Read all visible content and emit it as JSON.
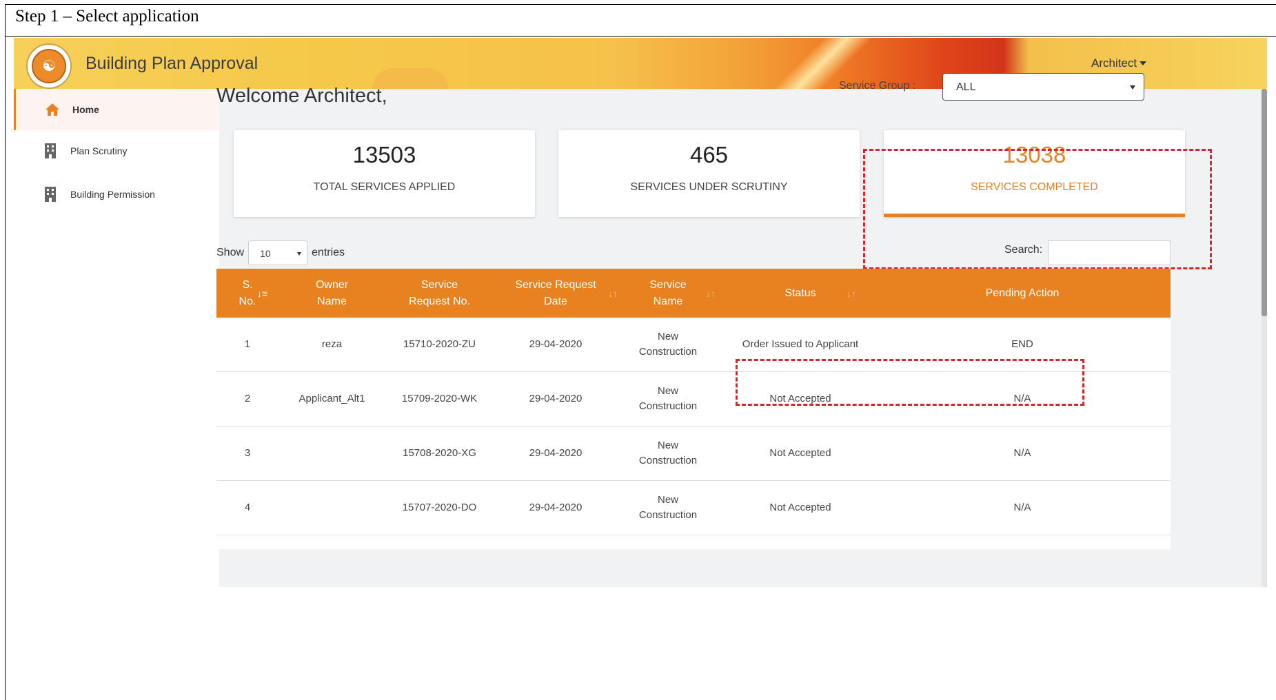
{
  "step_title": "Step 1 – Select application",
  "app": {
    "title": "Building Plan Approval",
    "user_menu": "Architect"
  },
  "sidebar": {
    "items": [
      {
        "label": "Home",
        "icon": "home-icon"
      },
      {
        "label": "Plan Scrutiny",
        "icon": "building-icon"
      },
      {
        "label": "Building Permission",
        "icon": "building-icon"
      }
    ]
  },
  "main": {
    "welcome": "Welcome Architect,",
    "service_group_label": "Service Group :",
    "service_group_value": "ALL",
    "cards": [
      {
        "value": "13503",
        "label": "TOTAL SERVICES APPLIED"
      },
      {
        "value": "465",
        "label": "SERVICES UNDER SCRUTINY"
      },
      {
        "value": "13038",
        "label": "SERVICES COMPLETED"
      }
    ],
    "show_label": "Show",
    "entries_value": "10",
    "entries_label": "entries",
    "search_label": "Search:"
  },
  "table": {
    "headers": [
      {
        "line1": "S.",
        "line2": "No."
      },
      {
        "line1": "Owner",
        "line2": "Name"
      },
      {
        "line1": "Service",
        "line2": "Request No."
      },
      {
        "line1": "Service Request",
        "line2": "Date"
      },
      {
        "line1": "Service",
        "line2": "Name"
      },
      {
        "line1": "Status",
        "line2": ""
      },
      {
        "line1": "Pending Action",
        "line2": ""
      }
    ],
    "rows": [
      {
        "sno": "1",
        "owner": "reza",
        "request_no": "15710-2020-ZU",
        "date": "29-04-2020",
        "service_line1": "New",
        "service_line2": "Construction",
        "status": "Order Issued to Applicant",
        "action": "END"
      },
      {
        "sno": "2",
        "owner": "Applicant_Alt1",
        "request_no": "15709-2020-WK",
        "date": "29-04-2020",
        "service_line1": "New",
        "service_line2": "Construction",
        "status": "Not Accepted",
        "action": "N/A"
      },
      {
        "sno": "3",
        "owner": "",
        "request_no": "15708-2020-XG",
        "date": "29-04-2020",
        "service_line1": "New",
        "service_line2": "Construction",
        "status": "Not Accepted",
        "action": "N/A"
      },
      {
        "sno": "4",
        "owner": "",
        "request_no": "15707-2020-DO",
        "date": "29-04-2020",
        "service_line1": "New",
        "service_line2": "Construction",
        "status": "Not Accepted",
        "action": "N/A"
      }
    ]
  },
  "colors": {
    "accent": "#e8811f",
    "highlight_border": "#d72528"
  }
}
